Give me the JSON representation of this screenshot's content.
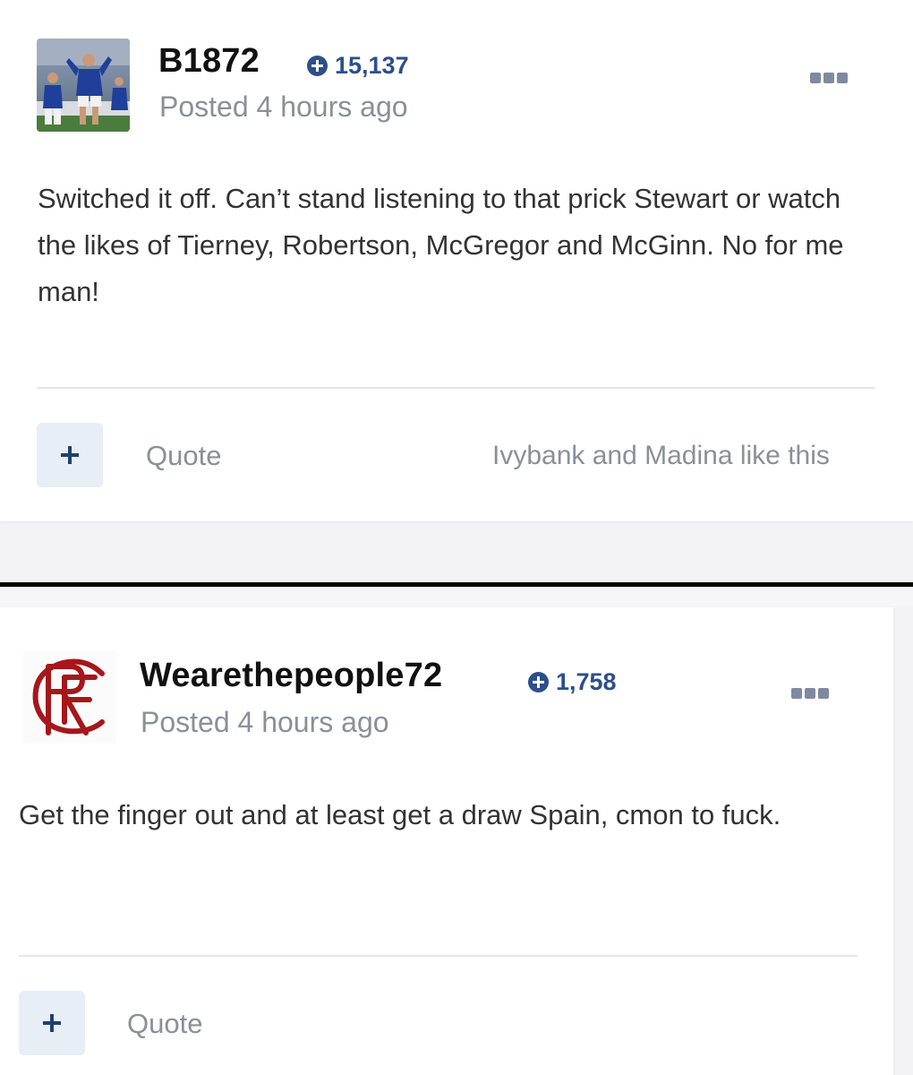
{
  "posts": [
    {
      "author": "B1872",
      "reputation": "15,137",
      "posted": "Posted 4 hours ago",
      "content": "Switched it off. Can’t stand listening to that prick Stewart or watch the likes of Tierney, Robertson, McGregor and McGinn. No for me man!",
      "actions": {
        "plus": "+",
        "quote": "Quote"
      },
      "likes": "Ivybank and Madina like this",
      "avatar": "football-player-photo",
      "menu_icon": "ellipsis-icon"
    },
    {
      "author": "Wearethepeople72",
      "reputation": "1,758",
      "posted": "Posted 4 hours ago",
      "content": "Get the finger out and at least get a draw Spain, cmon to fuck.",
      "actions": {
        "plus": "+",
        "quote": "Quote"
      },
      "avatar": "club-crest",
      "menu_icon": "ellipsis-icon"
    }
  ],
  "colors": {
    "reputation": "#2d4f8b",
    "muted_text": "#8a8f99",
    "plus_button_bg": "#e8eef6",
    "crest_red": "#a5171b"
  }
}
